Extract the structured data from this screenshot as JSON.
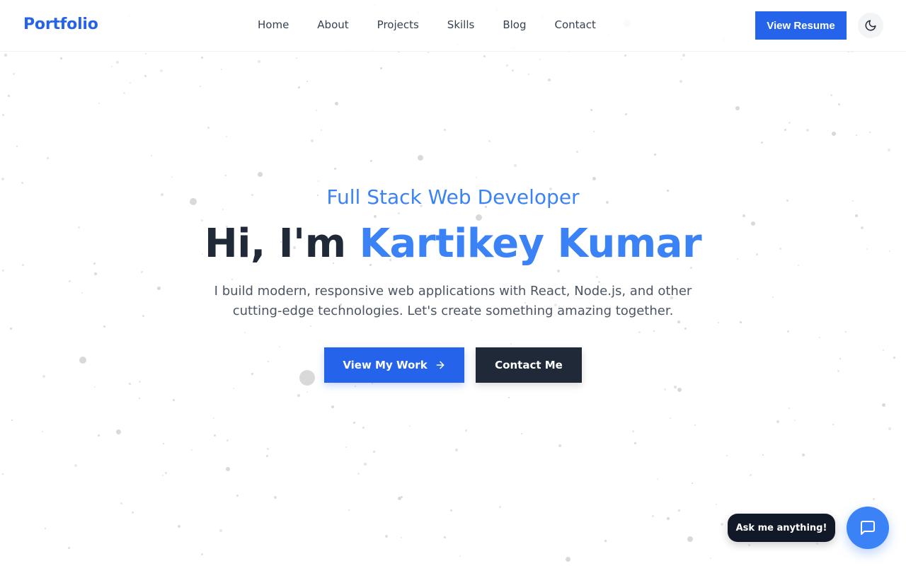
{
  "header": {
    "logo": "Portfolio",
    "nav": [
      "Home",
      "About",
      "Projects",
      "Skills",
      "Blog",
      "Contact"
    ],
    "resume_label": "View Resume",
    "theme_icon": "moon-icon"
  },
  "hero": {
    "subtitle": "Full Stack Web Developer",
    "greeting": "Hi, I'm",
    "name": "Kartikey Kumar",
    "description": "I build modern, responsive web applications with React, Node.js, and other cutting-edge technologies. Let's create something amazing together.",
    "primary_button": "View My Work",
    "primary_icon": "arrow-right-icon",
    "secondary_button": "Contact Me"
  },
  "chat": {
    "prompt": "Ask me anything!",
    "icon": "chat-icon"
  },
  "colors": {
    "accent": "#2563eb",
    "accent_light": "#3b82f6",
    "dark": "#1f2937"
  }
}
